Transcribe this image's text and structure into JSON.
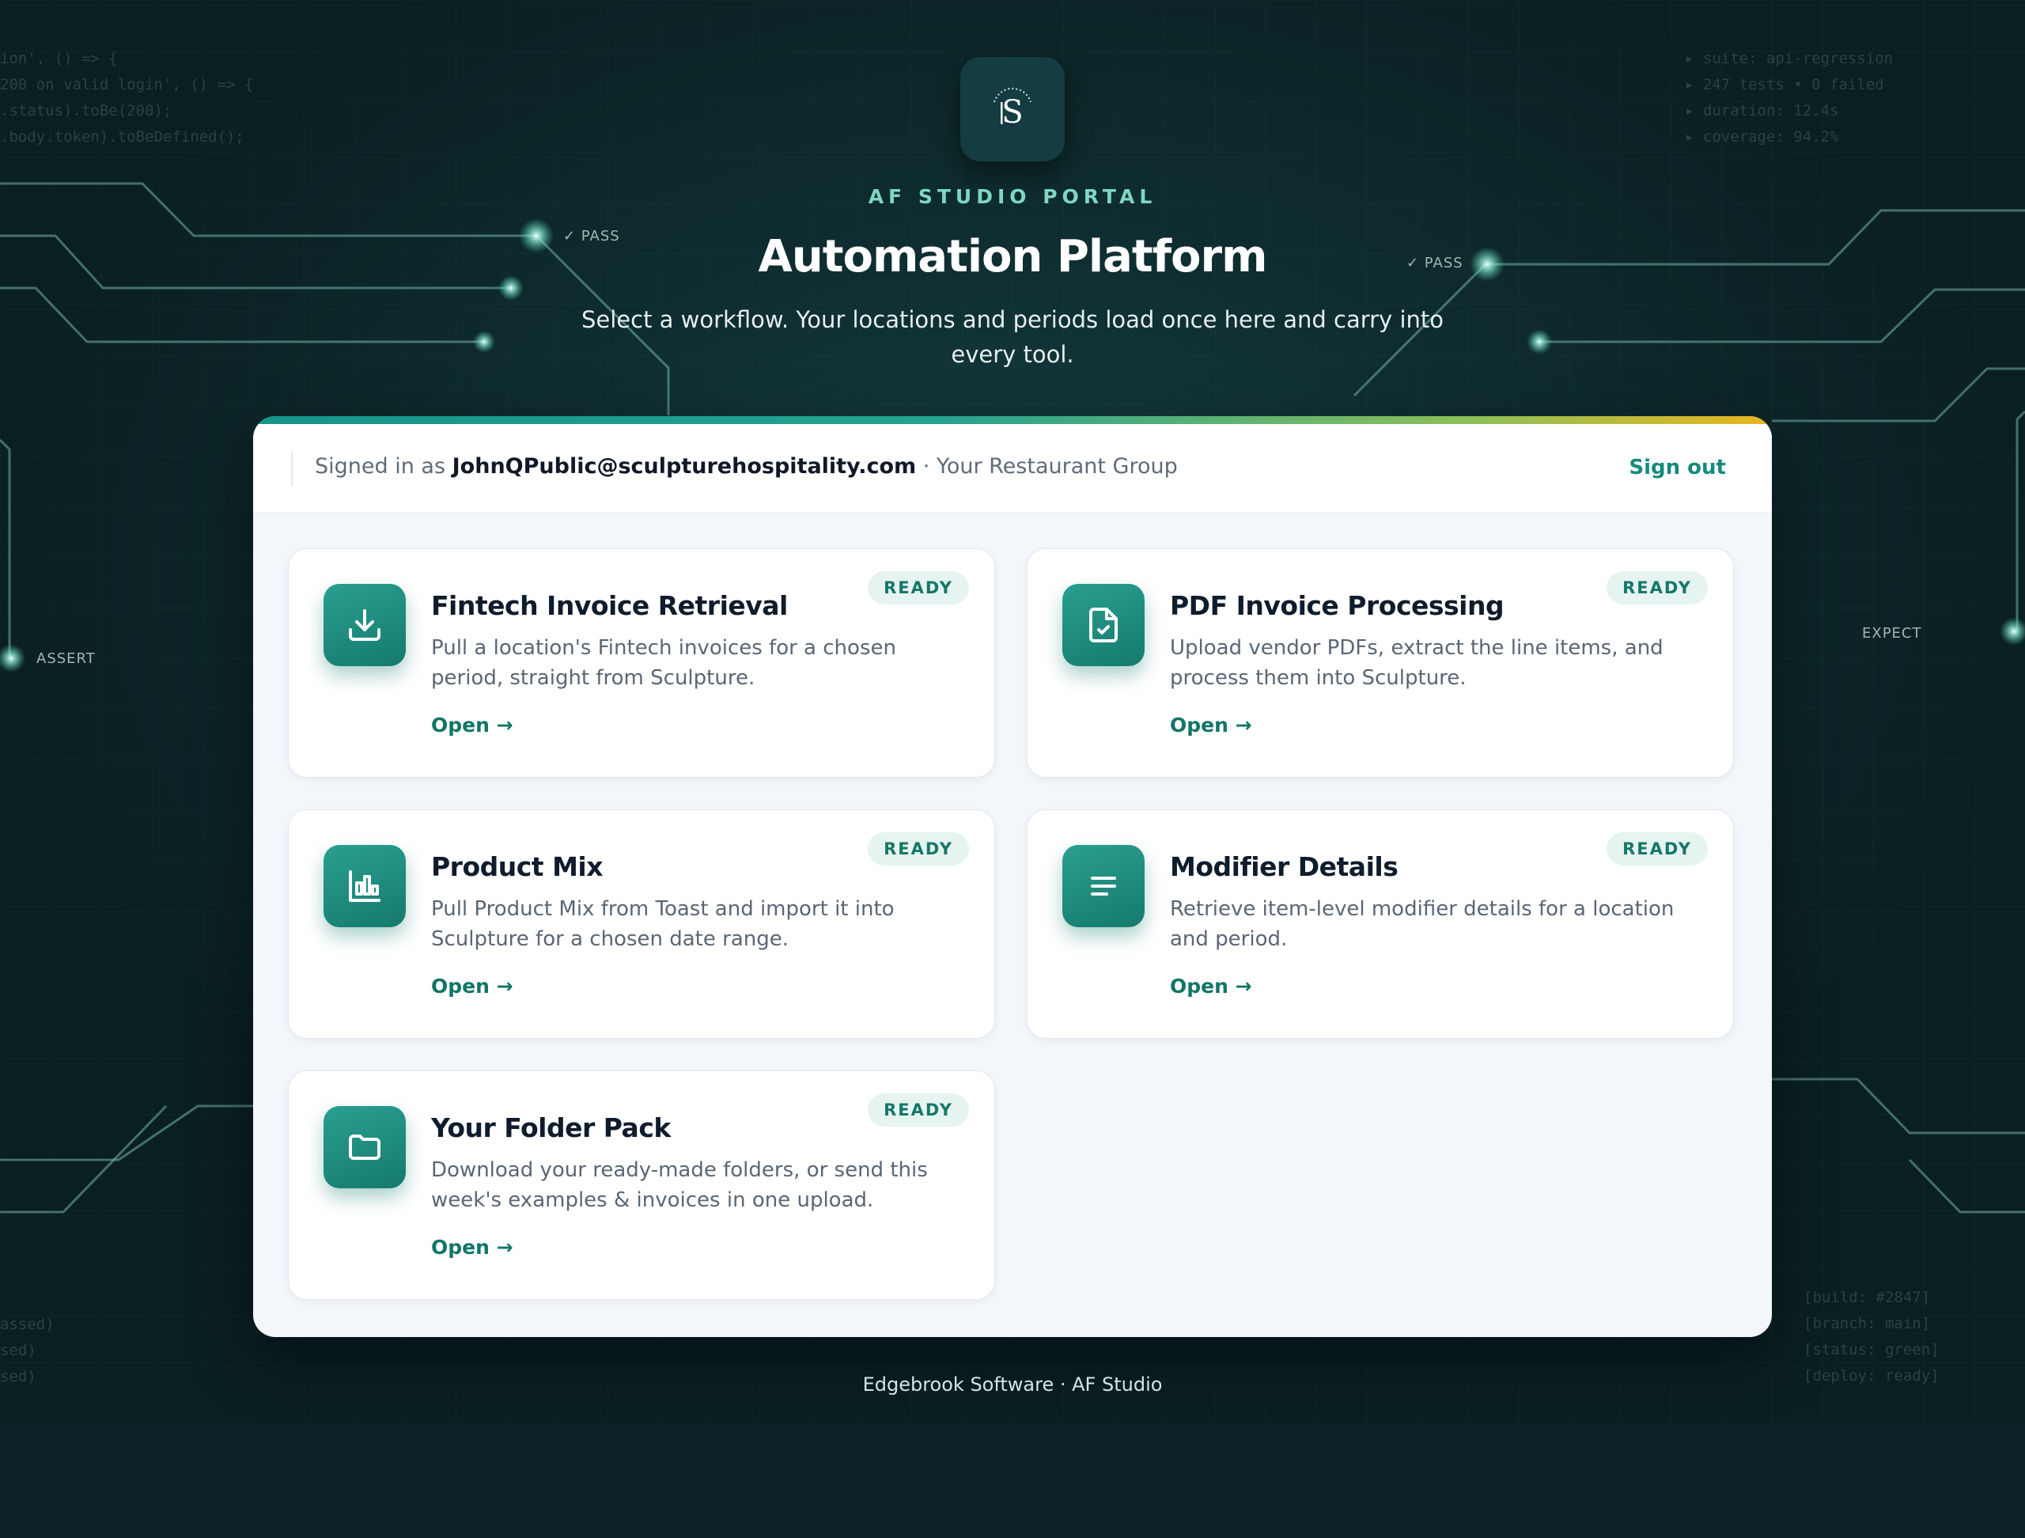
{
  "brand": {
    "eyebrow": "AF STUDIO PORTAL",
    "title": "Automation Platform",
    "subtitle": "Select a workflow. Your locations and periods load once here and carry into every tool.",
    "logo_icon": "af-studio-logo-icon"
  },
  "background": {
    "code_top_left": "ion', () => {\n200 on valid login', () => {\n.status).toBe(200);\n.body.token).toBeDefined();",
    "code_top_right": "▸ suite: api-regression\n▸ 247 tests • 0 failed\n▸ duration: 12.4s\n▸ coverage: 94.2%",
    "code_bottom_left": "assed)\nsed)\nsed)",
    "code_bottom_right": "[build: #2847]\n[branch: main]\n[status: green]\n[deploy: ready]",
    "tag_pass_left": "✓ PASS",
    "tag_pass_right": "✓ PASS",
    "tag_assert": "ASSERT",
    "tag_expect": "EXPECT"
  },
  "session": {
    "signed_in_prefix": "Signed in as",
    "email": "JohnQPublic@sculpturehospitality.com",
    "separator": " · ",
    "group": "Your Restaurant Group",
    "sign_out": "Sign out"
  },
  "workflows": [
    {
      "title": "Fintech Invoice Retrieval",
      "description": "Pull a location's Fintech invoices for a chosen period, straight from Sculpture.",
      "status": "READY",
      "open_label": "Open →",
      "icon": "download-icon"
    },
    {
      "title": "PDF Invoice Processing",
      "description": "Upload vendor PDFs, extract the line items, and process them into Sculpture.",
      "status": "READY",
      "open_label": "Open →",
      "icon": "file-check-icon"
    },
    {
      "title": "Product Mix",
      "description": "Pull Product Mix from Toast and import it into Sculpture for a chosen date range.",
      "status": "READY",
      "open_label": "Open →",
      "icon": "bar-chart-icon"
    },
    {
      "title": "Modifier Details",
      "description": "Retrieve item-level modifier details for a location and period.",
      "status": "READY",
      "open_label": "Open →",
      "icon": "list-lines-icon"
    },
    {
      "title": "Your Folder Pack",
      "description": "Download your ready-made folders, or send this week's examples & invoices in one upload.",
      "status": "READY",
      "open_label": "Open →",
      "icon": "folder-icon"
    }
  ],
  "footer": {
    "text": "Edgebrook Software · AF Studio"
  },
  "colors": {
    "accent": "#179488",
    "accent_dark": "#117565",
    "badge_bg": "#e5f4f0",
    "gradient_end": "#e9b61c",
    "background": "#0f2e31"
  }
}
